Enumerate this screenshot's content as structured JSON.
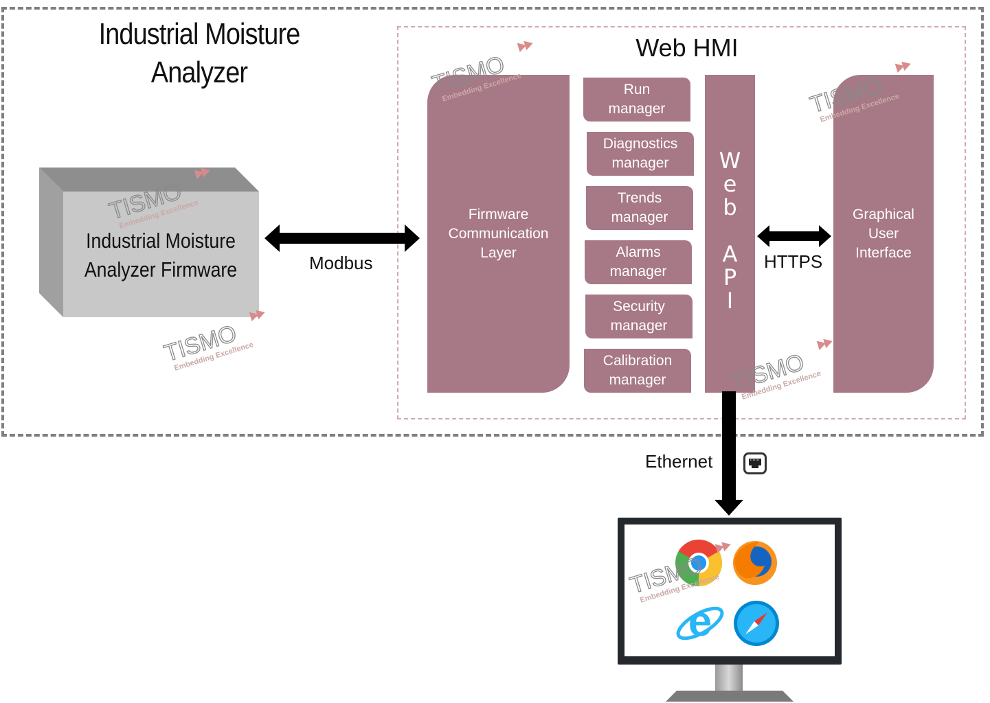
{
  "diagram": {
    "title": "Industrial Moisture Analyzer",
    "title_lines": [
      "Industrial Moisture",
      "Analyzer"
    ],
    "firmware_box": {
      "lines": [
        "Industrial Moisture",
        "Analyzer Firmware"
      ],
      "color": "#c8c8c8"
    },
    "web_hmi": {
      "title": "Web HMI",
      "block_color": "#a77885",
      "firmware_comm_layer": [
        "Firmware",
        "Communication",
        "Layer"
      ],
      "managers": [
        {
          "line1": "Run",
          "line2": "manager"
        },
        {
          "line1": "Diagnostics",
          "line2": "manager"
        },
        {
          "line1": "Trends",
          "line2": "manager"
        },
        {
          "line1": "Alarms",
          "line2": "manager"
        },
        {
          "line1": "Security",
          "line2": "manager"
        },
        {
          "line1": "Calibration",
          "line2": "manager"
        }
      ],
      "web_api_letters": [
        "W",
        "e",
        "b",
        "",
        "A",
        "P",
        "I"
      ],
      "gui": [
        "Graphical",
        "User",
        "Interface"
      ]
    },
    "connections": {
      "modbus": "Modbus",
      "https": "HTTPS",
      "ethernet": "Ethernet"
    },
    "icons": {
      "ethernet_port": "ethernet-port-icon",
      "browsers": [
        "chrome-icon",
        "firefox-icon",
        "internet-explorer-icon",
        "safari-icon"
      ],
      "monitor": "monitor-icon"
    },
    "watermark": {
      "brand": "TISMO",
      "tagline": "Embedding Excellence"
    }
  }
}
